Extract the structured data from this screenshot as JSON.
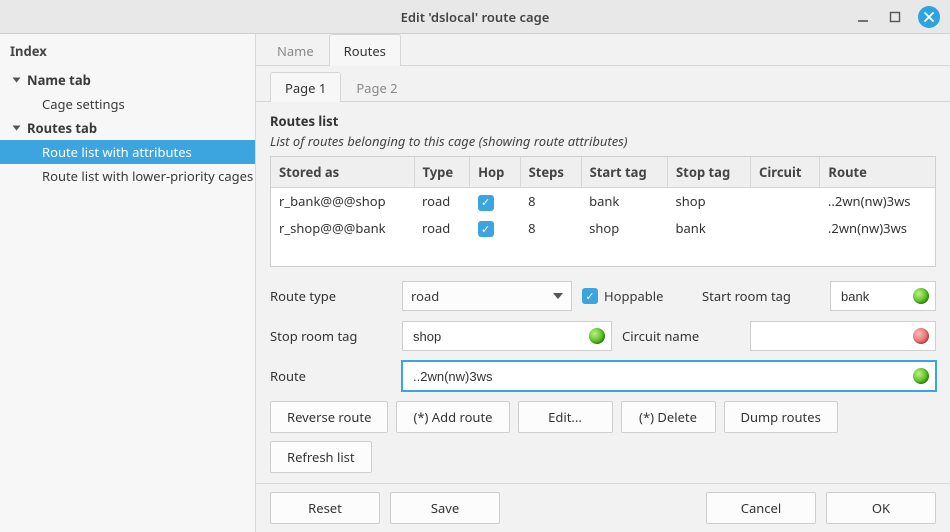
{
  "window": {
    "title": "Edit 'dslocal' route cage"
  },
  "sidebar": {
    "header": "Index",
    "cats": [
      {
        "label": "Name tab",
        "items": [
          {
            "label": "Cage settings",
            "selected": false
          }
        ]
      },
      {
        "label": "Routes tab",
        "items": [
          {
            "label": "Route list with attributes",
            "selected": true
          },
          {
            "label": "Route list with lower-priority cages",
            "selected": false
          }
        ]
      }
    ]
  },
  "tabs": {
    "items": [
      {
        "label": "Name",
        "active": false
      },
      {
        "label": "Routes",
        "active": true
      }
    ]
  },
  "subtabs": {
    "items": [
      {
        "label": "Page 1",
        "active": true
      },
      {
        "label": "Page 2",
        "active": false
      }
    ]
  },
  "list": {
    "title": "Routes list",
    "desc": "List of routes belonging to this cage (showing route attributes)",
    "headers": {
      "stored": "Stored as",
      "type": "Type",
      "hop": "Hop",
      "steps": "Steps",
      "start": "Start tag",
      "stop": "Stop tag",
      "circuit": "Circuit",
      "route": "Route"
    },
    "rows": [
      {
        "stored": "r_bank@@@shop",
        "type": "road",
        "hop": true,
        "steps": "8",
        "start": "bank",
        "stop": "shop",
        "circuit": "",
        "route": "..2wn(nw)3ws"
      },
      {
        "stored": "r_shop@@@bank",
        "type": "road",
        "hop": true,
        "steps": "8",
        "start": "shop",
        "stop": "bank",
        "circuit": "",
        "route": ".2wn(nw)3ws"
      }
    ]
  },
  "form": {
    "route_type": {
      "label": "Route type",
      "value": "road"
    },
    "hoppable": {
      "label": "Hoppable",
      "checked": true
    },
    "start_tag": {
      "label": "Start room tag",
      "value": "bank",
      "status": "green"
    },
    "stop_tag": {
      "label": "Stop room tag",
      "value": "shop",
      "status": "green"
    },
    "circuit": {
      "label": "Circuit name",
      "value": "",
      "status": "red"
    },
    "route": {
      "label": "Route",
      "value": "..2wn(nw)3ws",
      "status": "green"
    }
  },
  "buttons": {
    "reverse": "Reverse route",
    "add": "(*) Add route",
    "edit": "Edit...",
    "delete": "(*) Delete",
    "dump": "Dump routes",
    "refresh": "Refresh list"
  },
  "footer": {
    "reset": "Reset",
    "save": "Save",
    "cancel": "Cancel",
    "ok": "OK"
  }
}
